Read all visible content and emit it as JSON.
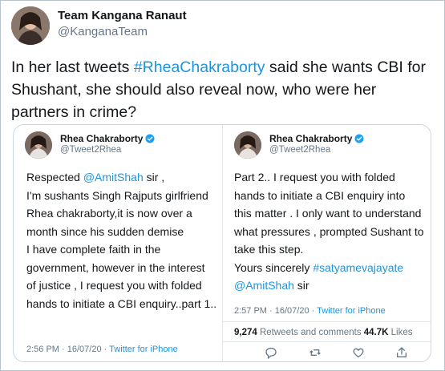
{
  "main_tweet": {
    "author_name": "Team Kangana Ranaut",
    "author_handle": "@KanganaTeam",
    "text_before": "In her last tweets ",
    "hashtag": "#RheaChakraborty",
    "text_after": " said  she wants CBI for Shushant, she should also reveal now, who were her partners in crime?"
  },
  "quote_left": {
    "author_name": "Rhea Chakraborty",
    "author_handle": "@Tweet2Rhea",
    "text_pre": "Respected ",
    "mention": "@AmitShah",
    "text_post": " sir  ,\nI'm sushants Singh Rajputs girlfriend Rhea chakraborty,it is now over a month since his sudden demise\nI have complete faith in the government, however in the interest of justice , I request you with folded hands to initiate a CBI enquiry..part 1..",
    "meta": "2:56 PM · 16/07/20 · ",
    "source": "Twitter for iPhone"
  },
  "quote_right": {
    "author_name": "Rhea Chakraborty",
    "author_handle": "@Tweet2Rhea",
    "text_main": "Part 2.. I request you with folded hands to initiate a CBI enquiry into this matter . I only want to understand what pressures  , prompted Sushant to take this step.\nYours sincerely ",
    "hashtag": "#satyamevajayate",
    "mention": "@AmitShah",
    "text_end": " sir",
    "meta": "2:57 PM · 16/07/20 · ",
    "source": "Twitter for iPhone",
    "retweets_count": "9,274",
    "retweets_label": " Retweets and comments ",
    "likes_count": "44.7K",
    "likes_label": " Likes"
  },
  "colors": {
    "link": "#1b95e0",
    "secondary_text": "#657786",
    "verified": "#1da1f2"
  },
  "icons": [
    "avatar",
    "verified-badge-icon",
    "reply-icon",
    "retweet-icon",
    "like-icon",
    "share-icon"
  ]
}
